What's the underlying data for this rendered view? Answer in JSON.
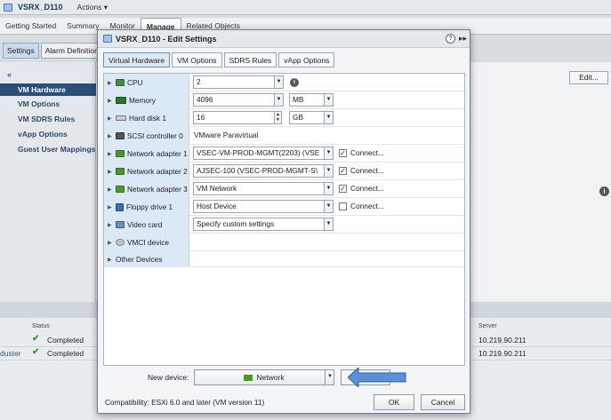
{
  "app": {
    "title": "VSRX_D110",
    "actions_label": "Actions ▾",
    "tabs": [
      {
        "label": "Getting Started"
      },
      {
        "label": "Summary"
      },
      {
        "label": "Monitor"
      },
      {
        "label": "Manage"
      },
      {
        "label": "Related Objects"
      }
    ],
    "subtabs": [
      {
        "label": "Settings"
      },
      {
        "label": "Alarm Definitions"
      }
    ],
    "nav": [
      {
        "label": "VM Hardware"
      },
      {
        "label": "VM Options"
      },
      {
        "label": "VM SDRS Rules"
      },
      {
        "label": "vApp Options"
      },
      {
        "label": "Guest User Mappings"
      }
    ],
    "edit_label": "Edit..."
  },
  "tasks": {
    "status_header": "Status",
    "server_header": "Server",
    "rows": [
      {
        "left_text": "",
        "status": "Completed",
        "server": "10.219.90.211"
      },
      {
        "left_text": "duster",
        "status": "Completed",
        "server": "10.219.90.211"
      }
    ]
  },
  "dialog": {
    "title": "VSRX_D110 - Edit Settings",
    "tabs": [
      {
        "label": "Virtual Hardware"
      },
      {
        "label": "VM Options"
      },
      {
        "label": "SDRS Rules"
      },
      {
        "label": "vApp Options"
      }
    ],
    "hardware": {
      "cpu": {
        "label": "CPU",
        "value": "2"
      },
      "memory": {
        "label": "Memory",
        "value": "4096",
        "unit": "MB"
      },
      "disk": {
        "label": "Hard disk 1",
        "value": "16",
        "unit": "GB"
      },
      "scsi": {
        "label": "SCSI controller 0",
        "value": "VMware Paravirtual"
      },
      "nic1": {
        "label": "Network adapter 1",
        "value": "VSEC-VM-PROD-MGMT(2203) (VSE",
        "connect": "Connect..."
      },
      "nic2": {
        "label": "Network adapter 2",
        "value": "AJSEC-100 (VSEC-PROD-MGMT-S\\",
        "connect": "Connect..."
      },
      "nic3": {
        "label": "Network adapter 3",
        "value": "VM Network",
        "connect": "Connect..."
      },
      "floppy": {
        "label": "Floppy drive 1",
        "value": "Host Device",
        "connect": "Connect..."
      },
      "video": {
        "label": "Video card",
        "value": "Specify custom settings"
      },
      "vmci": {
        "label": "VMCI device"
      },
      "other": {
        "label": "Other Devices"
      }
    },
    "new_device_label": "New device:",
    "new_device_value": "Network",
    "compatibility": "Compatibility: ESXi 6.0 and later (VM version 11)",
    "ok_label": "OK",
    "cancel_label": "Cancel"
  }
}
